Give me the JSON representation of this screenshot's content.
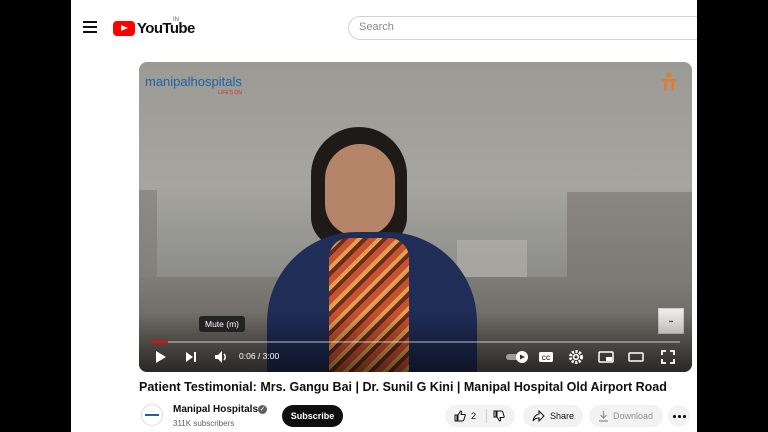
{
  "masthead": {
    "logo_text": "YouTube",
    "region": "IN",
    "search_placeholder": "Search"
  },
  "player": {
    "watermark_brand": "manipalhospitals",
    "watermark_tagline": "LIFE'S ON",
    "tooltip": "Mute (m)",
    "time": "0:06 / 3:00",
    "progress_fraction": 0.033
  },
  "video": {
    "title": "Patient Testimonial: Mrs. Gangu Bai | Dr. Sunil G Kini | Manipal Hospital Old Airport Road"
  },
  "channel": {
    "name": "Manipal Hospitals",
    "subscribers": "311K subscribers",
    "subscribe_label": "Subscribe"
  },
  "actions": {
    "like_count": "2",
    "share_label": "Share",
    "download_label": "Download"
  },
  "colors": {
    "accent": "#ff0000",
    "brand_blue": "#1c63a6"
  }
}
